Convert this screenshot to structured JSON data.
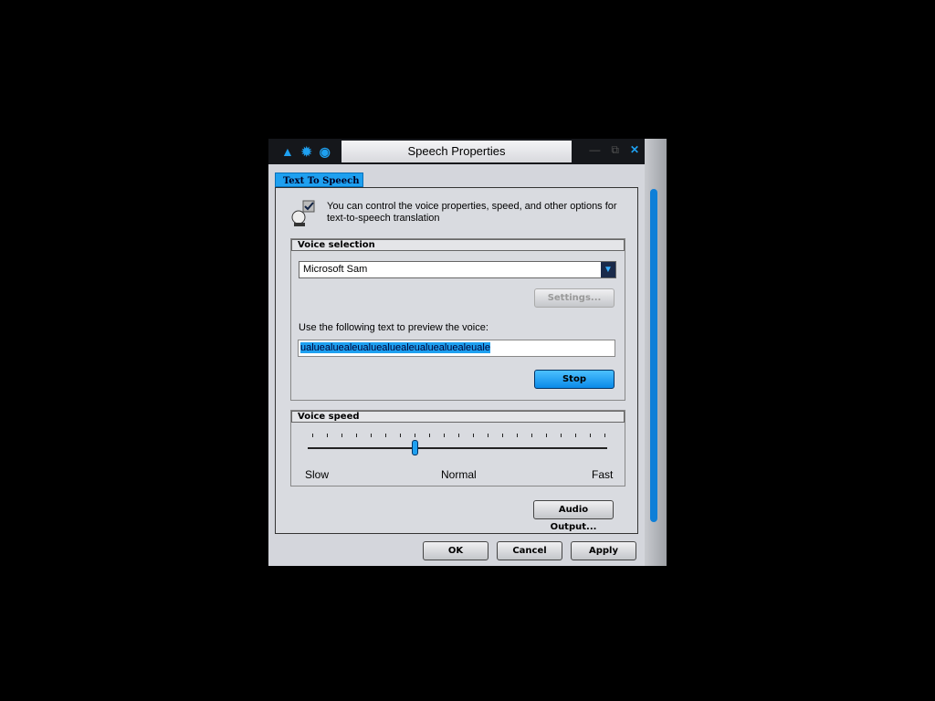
{
  "window": {
    "title": "Speech Properties",
    "tab": "Text To Speech"
  },
  "intro": "You can control the voice properties, speed, and other options for text-to-speech translation",
  "voice_selection": {
    "heading": "Voice selection",
    "selected_voice": "Microsoft Sam",
    "settings_label": "Settings...",
    "preview_label": "Use the following text to preview the voice:",
    "preview_text": "ualuealuealeualuealuealeualuealuealeuale",
    "stop_label": "Stop"
  },
  "voice_speed": {
    "heading": "Voice speed",
    "slow": "Slow",
    "normal": "Normal",
    "fast": "Fast",
    "ticks": 21,
    "value_fraction": 0.35
  },
  "audio_output_label": "Audio Output...",
  "footer": {
    "ok": "OK",
    "cancel": "Cancel",
    "apply": "Apply"
  },
  "colors": {
    "accent": "#1ea0f0",
    "titlebar": "#15171b"
  }
}
